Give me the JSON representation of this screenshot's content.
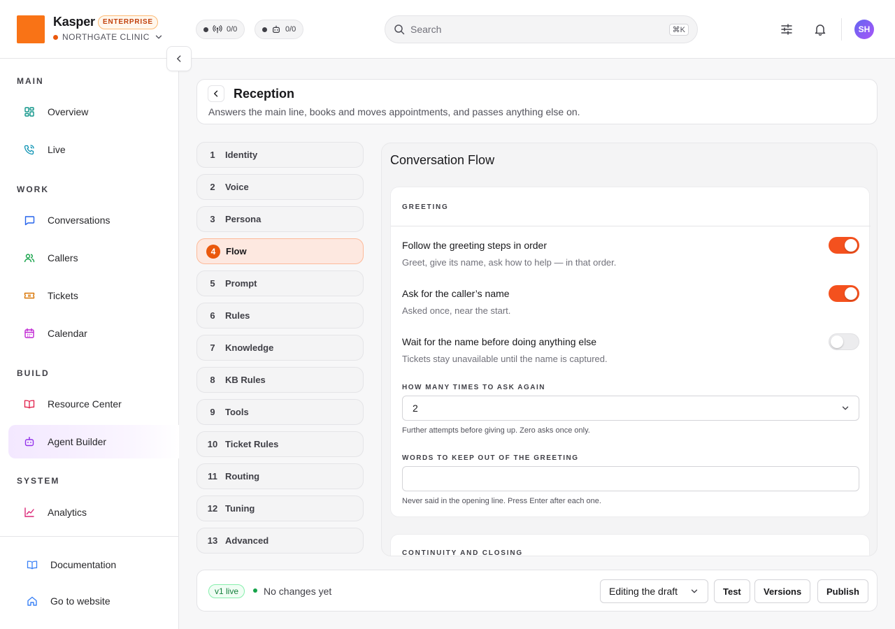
{
  "app": {
    "brand_name": "Kasper",
    "plan_badge": "ENTERPRISE",
    "org_name": "NORTHGATE CLINIC",
    "accent_color": "#f97316"
  },
  "topbar": {
    "live_calls_counter": "0/0",
    "agents_counter": "0/0",
    "search_placeholder": "Search",
    "search_shortcut": "⌘K",
    "avatar_initials": "SH"
  },
  "sidebar": {
    "sections": {
      "main": "MAIN",
      "work": "WORK",
      "build": "BUILD",
      "system": "SYSTEM"
    },
    "items": {
      "overview": "Overview",
      "live": "Live",
      "conversations": "Conversations",
      "callers": "Callers",
      "tickets": "Tickets",
      "calendar": "Calendar",
      "resource_center": "Resource Center",
      "agent_builder": "Agent Builder",
      "analytics": "Analytics"
    },
    "active_item": "agent_builder",
    "footer": {
      "documentation": "Documentation",
      "go_to_website": "Go to website"
    }
  },
  "header": {
    "title": "Reception",
    "subtitle": "Answers the main line, books and moves appointments, and passes anything else on."
  },
  "steps": [
    {
      "num": "1",
      "label": "Identity"
    },
    {
      "num": "2",
      "label": "Voice"
    },
    {
      "num": "3",
      "label": "Persona"
    },
    {
      "num": "4",
      "label": "Flow"
    },
    {
      "num": "5",
      "label": "Prompt"
    },
    {
      "num": "6",
      "label": "Rules"
    },
    {
      "num": "7",
      "label": "Knowledge"
    },
    {
      "num": "8",
      "label": "KB Rules"
    },
    {
      "num": "9",
      "label": "Tools"
    },
    {
      "num": "10",
      "label": "Ticket Rules"
    },
    {
      "num": "11",
      "label": "Routing"
    },
    {
      "num": "12",
      "label": "Tuning"
    },
    {
      "num": "13",
      "label": "Advanced"
    }
  ],
  "active_step": "4",
  "flow": {
    "title": "Conversation Flow",
    "greeting": {
      "heading": "GREETING",
      "options": [
        {
          "title": "Follow the greeting steps in order",
          "desc": "Greet, give its name, ask how to help — in that order.",
          "enabled": true
        },
        {
          "title": "Ask for the caller’s name",
          "desc": "Asked once, near the start.",
          "enabled": true
        },
        {
          "title": "Wait for the name before doing anything else",
          "desc": "Tickets stay unavailable until the name is captured.",
          "enabled": false
        }
      ],
      "retry": {
        "label": "HOW MANY TIMES TO ASK AGAIN",
        "value": "2",
        "hint": "Further attempts before giving up. Zero asks once only."
      },
      "blocked_words": {
        "label": "WORDS TO KEEP OUT OF THE GREETING",
        "value": "",
        "hint": "Never said in the opening line. Press Enter after each one."
      }
    },
    "continuity": {
      "heading": "CONTINUITY AND CLOSING"
    }
  },
  "footer": {
    "version_badge": "v1 live",
    "status_text": "No changes yet",
    "mode_value": "Editing the draft",
    "test_label": "Test",
    "versions_label": "Versions",
    "publish_label": "Publish"
  },
  "colors": {
    "toggle_on": "#f4511e",
    "active_step_bg": "#fde8e0",
    "live_green": "#16a34a"
  }
}
